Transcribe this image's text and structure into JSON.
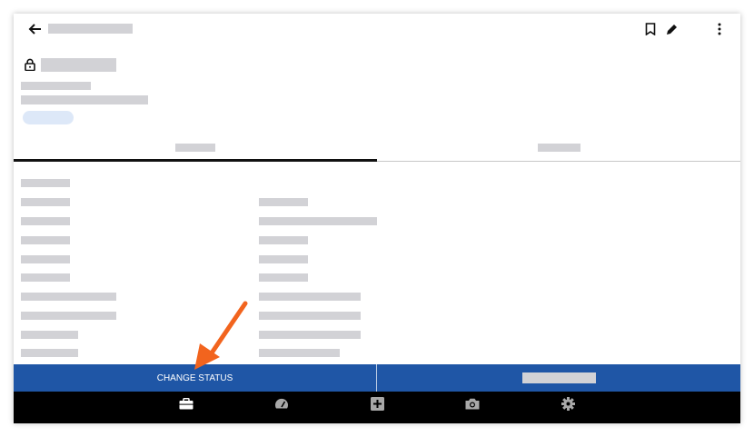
{
  "colors": {
    "placeholder": "#d2d2d6",
    "status_pill": "#dde8f8",
    "action_bar": "#1f56a6",
    "bottom_nav": "#000000",
    "annotation_arrow": "#f2641e"
  },
  "toolbar": {
    "back_icon": "arrow-left-icon",
    "actions": [
      "bookmark-icon",
      "edit-pencil-icon",
      "more-vertical-icon"
    ]
  },
  "header": {
    "lock_icon": "lock-icon"
  },
  "action_bar": {
    "change_status_label": "CHANGE STATUS"
  },
  "bottom_nav": {
    "items": [
      "briefcase-icon",
      "speedometer-icon",
      "add-box-icon",
      "camera-icon",
      "settings-gear-icon"
    ]
  },
  "annotation": {
    "type": "arrow",
    "color": "#f2641e"
  }
}
